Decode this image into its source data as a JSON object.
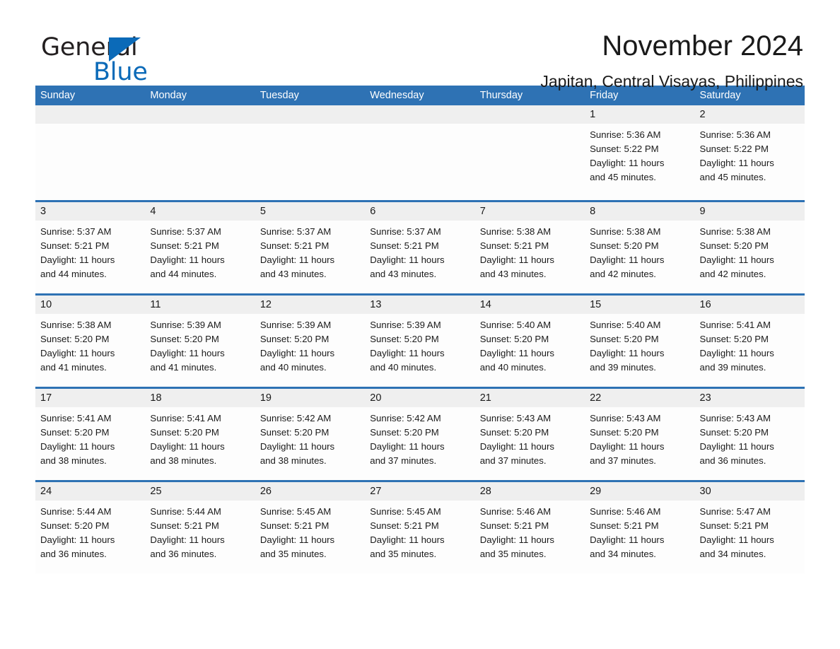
{
  "brand": {
    "word_one": "General",
    "word_two": "Blue",
    "triangle_icon": "triangle-icon",
    "accent_color": "#0b6ab8"
  },
  "header": {
    "month_title": "November 2024",
    "location": "Japitan, Central Visayas, Philippines"
  },
  "theme": {
    "header_blue": "#2e72b4",
    "day_band_gray": "#efefef",
    "text": "#1a1a1a"
  },
  "calendar": {
    "weekdays": [
      "Sunday",
      "Monday",
      "Tuesday",
      "Wednesday",
      "Thursday",
      "Friday",
      "Saturday"
    ],
    "weeks": [
      [
        {
          "day": "",
          "sunrise": "",
          "sunset": "",
          "daylight_line1": "",
          "daylight_line2": ""
        },
        {
          "day": "",
          "sunrise": "",
          "sunset": "",
          "daylight_line1": "",
          "daylight_line2": ""
        },
        {
          "day": "",
          "sunrise": "",
          "sunset": "",
          "daylight_line1": "",
          "daylight_line2": ""
        },
        {
          "day": "",
          "sunrise": "",
          "sunset": "",
          "daylight_line1": "",
          "daylight_line2": ""
        },
        {
          "day": "",
          "sunrise": "",
          "sunset": "",
          "daylight_line1": "",
          "daylight_line2": ""
        },
        {
          "day": "1",
          "sunrise": "Sunrise: 5:36 AM",
          "sunset": "Sunset: 5:22 PM",
          "daylight_line1": "Daylight: 11 hours",
          "daylight_line2": "and 45 minutes."
        },
        {
          "day": "2",
          "sunrise": "Sunrise: 5:36 AM",
          "sunset": "Sunset: 5:22 PM",
          "daylight_line1": "Daylight: 11 hours",
          "daylight_line2": "and 45 minutes."
        }
      ],
      [
        {
          "day": "3",
          "sunrise": "Sunrise: 5:37 AM",
          "sunset": "Sunset: 5:21 PM",
          "daylight_line1": "Daylight: 11 hours",
          "daylight_line2": "and 44 minutes."
        },
        {
          "day": "4",
          "sunrise": "Sunrise: 5:37 AM",
          "sunset": "Sunset: 5:21 PM",
          "daylight_line1": "Daylight: 11 hours",
          "daylight_line2": "and 44 minutes."
        },
        {
          "day": "5",
          "sunrise": "Sunrise: 5:37 AM",
          "sunset": "Sunset: 5:21 PM",
          "daylight_line1": "Daylight: 11 hours",
          "daylight_line2": "and 43 minutes."
        },
        {
          "day": "6",
          "sunrise": "Sunrise: 5:37 AM",
          "sunset": "Sunset: 5:21 PM",
          "daylight_line1": "Daylight: 11 hours",
          "daylight_line2": "and 43 minutes."
        },
        {
          "day": "7",
          "sunrise": "Sunrise: 5:38 AM",
          "sunset": "Sunset: 5:21 PM",
          "daylight_line1": "Daylight: 11 hours",
          "daylight_line2": "and 43 minutes."
        },
        {
          "day": "8",
          "sunrise": "Sunrise: 5:38 AM",
          "sunset": "Sunset: 5:20 PM",
          "daylight_line1": "Daylight: 11 hours",
          "daylight_line2": "and 42 minutes."
        },
        {
          "day": "9",
          "sunrise": "Sunrise: 5:38 AM",
          "sunset": "Sunset: 5:20 PM",
          "daylight_line1": "Daylight: 11 hours",
          "daylight_line2": "and 42 minutes."
        }
      ],
      [
        {
          "day": "10",
          "sunrise": "Sunrise: 5:38 AM",
          "sunset": "Sunset: 5:20 PM",
          "daylight_line1": "Daylight: 11 hours",
          "daylight_line2": "and 41 minutes."
        },
        {
          "day": "11",
          "sunrise": "Sunrise: 5:39 AM",
          "sunset": "Sunset: 5:20 PM",
          "daylight_line1": "Daylight: 11 hours",
          "daylight_line2": "and 41 minutes."
        },
        {
          "day": "12",
          "sunrise": "Sunrise: 5:39 AM",
          "sunset": "Sunset: 5:20 PM",
          "daylight_line1": "Daylight: 11 hours",
          "daylight_line2": "and 40 minutes."
        },
        {
          "day": "13",
          "sunrise": "Sunrise: 5:39 AM",
          "sunset": "Sunset: 5:20 PM",
          "daylight_line1": "Daylight: 11 hours",
          "daylight_line2": "and 40 minutes."
        },
        {
          "day": "14",
          "sunrise": "Sunrise: 5:40 AM",
          "sunset": "Sunset: 5:20 PM",
          "daylight_line1": "Daylight: 11 hours",
          "daylight_line2": "and 40 minutes."
        },
        {
          "day": "15",
          "sunrise": "Sunrise: 5:40 AM",
          "sunset": "Sunset: 5:20 PM",
          "daylight_line1": "Daylight: 11 hours",
          "daylight_line2": "and 39 minutes."
        },
        {
          "day": "16",
          "sunrise": "Sunrise: 5:41 AM",
          "sunset": "Sunset: 5:20 PM",
          "daylight_line1": "Daylight: 11 hours",
          "daylight_line2": "and 39 minutes."
        }
      ],
      [
        {
          "day": "17",
          "sunrise": "Sunrise: 5:41 AM",
          "sunset": "Sunset: 5:20 PM",
          "daylight_line1": "Daylight: 11 hours",
          "daylight_line2": "and 38 minutes."
        },
        {
          "day": "18",
          "sunrise": "Sunrise: 5:41 AM",
          "sunset": "Sunset: 5:20 PM",
          "daylight_line1": "Daylight: 11 hours",
          "daylight_line2": "and 38 minutes."
        },
        {
          "day": "19",
          "sunrise": "Sunrise: 5:42 AM",
          "sunset": "Sunset: 5:20 PM",
          "daylight_line1": "Daylight: 11 hours",
          "daylight_line2": "and 38 minutes."
        },
        {
          "day": "20",
          "sunrise": "Sunrise: 5:42 AM",
          "sunset": "Sunset: 5:20 PM",
          "daylight_line1": "Daylight: 11 hours",
          "daylight_line2": "and 37 minutes."
        },
        {
          "day": "21",
          "sunrise": "Sunrise: 5:43 AM",
          "sunset": "Sunset: 5:20 PM",
          "daylight_line1": "Daylight: 11 hours",
          "daylight_line2": "and 37 minutes."
        },
        {
          "day": "22",
          "sunrise": "Sunrise: 5:43 AM",
          "sunset": "Sunset: 5:20 PM",
          "daylight_line1": "Daylight: 11 hours",
          "daylight_line2": "and 37 minutes."
        },
        {
          "day": "23",
          "sunrise": "Sunrise: 5:43 AM",
          "sunset": "Sunset: 5:20 PM",
          "daylight_line1": "Daylight: 11 hours",
          "daylight_line2": "and 36 minutes."
        }
      ],
      [
        {
          "day": "24",
          "sunrise": "Sunrise: 5:44 AM",
          "sunset": "Sunset: 5:20 PM",
          "daylight_line1": "Daylight: 11 hours",
          "daylight_line2": "and 36 minutes."
        },
        {
          "day": "25",
          "sunrise": "Sunrise: 5:44 AM",
          "sunset": "Sunset: 5:21 PM",
          "daylight_line1": "Daylight: 11 hours",
          "daylight_line2": "and 36 minutes."
        },
        {
          "day": "26",
          "sunrise": "Sunrise: 5:45 AM",
          "sunset": "Sunset: 5:21 PM",
          "daylight_line1": "Daylight: 11 hours",
          "daylight_line2": "and 35 minutes."
        },
        {
          "day": "27",
          "sunrise": "Sunrise: 5:45 AM",
          "sunset": "Sunset: 5:21 PM",
          "daylight_line1": "Daylight: 11 hours",
          "daylight_line2": "and 35 minutes."
        },
        {
          "day": "28",
          "sunrise": "Sunrise: 5:46 AM",
          "sunset": "Sunset: 5:21 PM",
          "daylight_line1": "Daylight: 11 hours",
          "daylight_line2": "and 35 minutes."
        },
        {
          "day": "29",
          "sunrise": "Sunrise: 5:46 AM",
          "sunset": "Sunset: 5:21 PM",
          "daylight_line1": "Daylight: 11 hours",
          "daylight_line2": "and 34 minutes."
        },
        {
          "day": "30",
          "sunrise": "Sunrise: 5:47 AM",
          "sunset": "Sunset: 5:21 PM",
          "daylight_line1": "Daylight: 11 hours",
          "daylight_line2": "and 34 minutes."
        }
      ]
    ]
  }
}
